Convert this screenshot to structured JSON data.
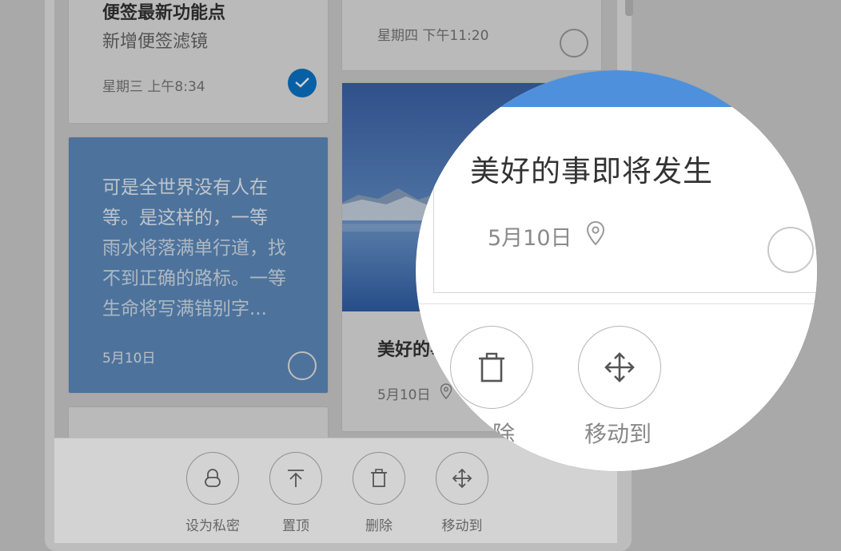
{
  "notes": [
    {
      "title": "便签最新功能点",
      "subtitle": "新增便签滤镜",
      "date": "星期三 上午8:34",
      "selected": true
    },
    {
      "date": "星期四 下午11:20",
      "selected": false
    },
    {
      "lines": [
        "可是全世界没有人在",
        "等。是这样的，一等",
        "雨水将落满单行道，找",
        "不到正确的路标。一等",
        "生命将写满错别字..."
      ],
      "date": "5月10日",
      "selected": false
    },
    {
      "title": "美好的事即将发生",
      "date": "5月10日",
      "selected": false
    }
  ],
  "toolbar": [
    {
      "label": "设为私密",
      "icon": "lock-icon"
    },
    {
      "label": "置顶",
      "icon": "pin-top-icon"
    },
    {
      "label": "删除",
      "icon": "trash-icon"
    },
    {
      "label": "移动到",
      "icon": "move-icon"
    }
  ],
  "zoom": {
    "title": "美好的事即将发生",
    "date": "5月10日",
    "delete_label_partial": "除",
    "move_label": "移动到"
  },
  "colors": {
    "accent": "#0a74c9",
    "blue_card": "#5f8dbf",
    "zoom_sky": "#4e90db"
  }
}
